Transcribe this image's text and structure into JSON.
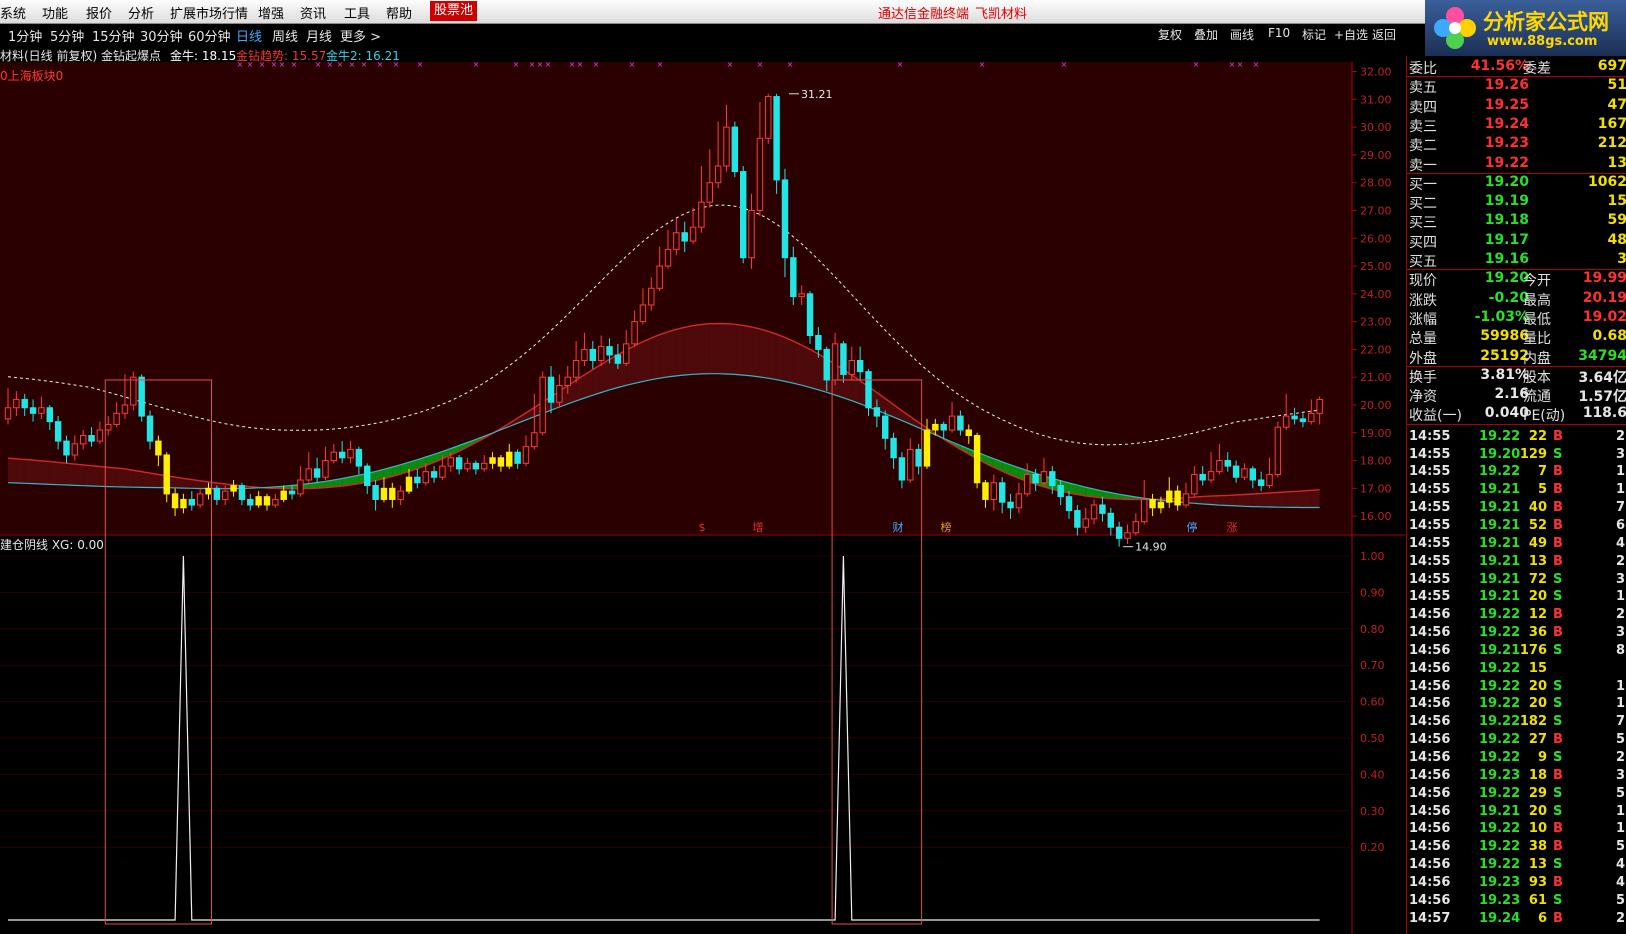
{
  "menu": [
    "系统",
    "功能",
    "报价",
    "分析",
    "扩展市场行情",
    "增强",
    "资讯",
    "工具",
    "帮助"
  ],
  "menu_pool": "股票池",
  "menu_center": [
    "通达信金融终端",
    "飞凯材料"
  ],
  "logo": {
    "title": "分析家公式网",
    "url": "www.88gs.com"
  },
  "periods": [
    "1分钟",
    "5分钟",
    "15分钟",
    "30分钟",
    "60分钟",
    "日线",
    "周线",
    "月线",
    "更多 >"
  ],
  "active_period": "日线",
  "toolbar_right": [
    "复权",
    "叠加",
    "画线",
    "F10",
    "标记",
    "+自选",
    "返回"
  ],
  "info": {
    "title": "材料(日线 前复权) 金钻起爆点",
    "items": [
      {
        "text": "金牛: 18.15",
        "color": "#ffffff"
      },
      {
        "text": "金钻趋势: 15.57",
        "color": "#ff3030"
      },
      {
        "text": "金牛2: 16.21",
        "color": "#33d0e8"
      }
    ]
  },
  "sub_label": "0上海板块0",
  "indicator_label": "建仓阴线 XG: 0.00",
  "price_axis": [
    "32.00",
    "31.00",
    "30.00",
    "29.00",
    "28.00",
    "27.00",
    "26.00",
    "25.00",
    "24.00",
    "23.00",
    "22.00",
    "21.00",
    "20.00",
    "19.00",
    "18.00",
    "17.00",
    "16.00"
  ],
  "ind_axis": [
    "1.00",
    "0.90",
    "0.80",
    "0.70",
    "0.60",
    "0.50",
    "0.40",
    "0.30",
    "0.20"
  ],
  "annotations": {
    "high": "31.21",
    "low": "14.90"
  },
  "event_marks": [
    "$",
    "增",
    "财",
    "榜",
    "停",
    "涨"
  ],
  "colors": {
    "bg_upper": "#2a0000",
    "up": "#ff3a3a",
    "down": "#22e6e6",
    "green_band": "#0c8a0c",
    "red_band": "#4e0a0a",
    "yellow": "#ffee00"
  },
  "chart_data": {
    "type": "candlestick",
    "ylim": [
      15.5,
      32.2
    ],
    "bars": [
      [
        19.5,
        19.9,
        20.6,
        19.3
      ],
      [
        19.9,
        20.2,
        20.5,
        19.6
      ],
      [
        20.2,
        19.9,
        20.4,
        19.6
      ],
      [
        19.9,
        19.7,
        20.2,
        19.4
      ],
      [
        19.7,
        19.9,
        20.3,
        19.5
      ],
      [
        19.9,
        19.4,
        20.0,
        19.1
      ],
      [
        19.4,
        18.7,
        19.6,
        18.4
      ],
      [
        18.7,
        18.2,
        18.9,
        17.9
      ],
      [
        18.2,
        18.6,
        18.9,
        18.0
      ],
      [
        18.6,
        18.9,
        19.1,
        18.4
      ],
      [
        18.9,
        18.7,
        19.2,
        18.5
      ],
      [
        18.7,
        19.1,
        19.4,
        18.6
      ],
      [
        19.1,
        19.3,
        19.6,
        18.9
      ],
      [
        19.3,
        19.7,
        20.1,
        19.2
      ],
      [
        19.7,
        20.0,
        21.1,
        19.5
      ],
      [
        20.0,
        21.0,
        21.2,
        19.8
      ],
      [
        21.0,
        19.6,
        21.1,
        19.4
      ],
      [
        19.6,
        18.7,
        19.8,
        18.4
      ],
      [
        18.7,
        18.2,
        18.9,
        17.8
      ],
      [
        18.2,
        16.8,
        18.3,
        16.5
      ],
      [
        16.8,
        16.3,
        17.0,
        16.0
      ],
      [
        16.3,
        16.6,
        16.8,
        16.1
      ],
      [
        16.6,
        16.4,
        16.9,
        16.2
      ],
      [
        16.4,
        16.8,
        17.0,
        16.3
      ],
      [
        16.8,
        17.0,
        17.2,
        16.6
      ],
      [
        17.0,
        16.6,
        17.1,
        16.4
      ],
      [
        16.6,
        16.9,
        17.1,
        16.4
      ],
      [
        16.9,
        17.1,
        17.3,
        16.7
      ],
      [
        17.1,
        16.6,
        17.2,
        16.4
      ],
      [
        16.6,
        16.4,
        16.8,
        16.2
      ],
      [
        16.4,
        16.7,
        16.9,
        16.3
      ],
      [
        16.7,
        16.4,
        16.8,
        16.2
      ],
      [
        16.4,
        16.6,
        16.8,
        16.3
      ],
      [
        16.6,
        16.9,
        17.1,
        16.5
      ],
      [
        16.9,
        16.8,
        17.1,
        16.6
      ],
      [
        16.8,
        17.3,
        17.8,
        16.7
      ],
      [
        17.3,
        17.7,
        18.3,
        17.2
      ],
      [
        17.7,
        17.4,
        18.1,
        17.2
      ],
      [
        17.4,
        18.0,
        18.5,
        17.3
      ],
      [
        18.0,
        18.3,
        18.6,
        17.9
      ],
      [
        18.3,
        18.1,
        18.7,
        17.9
      ],
      [
        18.1,
        18.4,
        18.7,
        17.9
      ],
      [
        18.4,
        17.8,
        18.5,
        17.5
      ],
      [
        17.8,
        17.1,
        17.9,
        16.8
      ],
      [
        17.1,
        16.6,
        17.3,
        16.2
      ],
      [
        16.6,
        17.0,
        17.4,
        16.5
      ],
      [
        17.0,
        16.6,
        17.2,
        16.3
      ],
      [
        16.6,
        16.9,
        17.1,
        16.4
      ],
      [
        16.9,
        17.4,
        17.7,
        16.8
      ],
      [
        17.4,
        17.2,
        17.7,
        17.0
      ],
      [
        17.2,
        17.6,
        17.9,
        17.1
      ],
      [
        17.6,
        17.4,
        17.8,
        17.2
      ],
      [
        17.4,
        17.8,
        18.2,
        17.3
      ],
      [
        17.8,
        18.1,
        18.3,
        17.6
      ],
      [
        18.1,
        17.7,
        18.2,
        17.5
      ],
      [
        17.7,
        17.9,
        18.1,
        17.6
      ],
      [
        17.9,
        17.7,
        18.0,
        17.5
      ],
      [
        17.7,
        17.9,
        18.2,
        17.6
      ],
      [
        17.9,
        18.1,
        18.3,
        17.7
      ],
      [
        18.1,
        17.8,
        18.2,
        17.6
      ],
      [
        17.8,
        18.3,
        18.6,
        17.7
      ],
      [
        18.3,
        17.9,
        18.4,
        17.7
      ],
      [
        17.9,
        18.5,
        18.9,
        17.8
      ],
      [
        18.5,
        19.0,
        20.4,
        18.4
      ],
      [
        19.0,
        21.0,
        21.2,
        18.9
      ],
      [
        21.0,
        20.1,
        21.4,
        19.7
      ],
      [
        20.1,
        20.7,
        21.1,
        19.9
      ],
      [
        20.7,
        21.0,
        21.4,
        20.4
      ],
      [
        21.0,
        21.6,
        22.3,
        20.8
      ],
      [
        21.6,
        22.0,
        22.6,
        21.4
      ],
      [
        22.0,
        21.6,
        22.3,
        21.3
      ],
      [
        21.6,
        22.1,
        22.5,
        21.4
      ],
      [
        22.1,
        21.8,
        22.4,
        21.5
      ],
      [
        21.8,
        21.5,
        22.2,
        21.3
      ],
      [
        21.5,
        22.2,
        22.7,
        21.4
      ],
      [
        22.2,
        23.0,
        23.4,
        22.1
      ],
      [
        23.0,
        23.6,
        24.2,
        22.9
      ],
      [
        23.6,
        24.2,
        24.6,
        23.4
      ],
      [
        24.2,
        25.0,
        25.7,
        24.1
      ],
      [
        25.0,
        25.6,
        26.3,
        24.9
      ],
      [
        25.6,
        26.2,
        26.7,
        25.4
      ],
      [
        26.2,
        25.9,
        26.6,
        25.5
      ],
      [
        25.9,
        26.4,
        27.1,
        25.8
      ],
      [
        26.4,
        27.3,
        28.6,
        26.2
      ],
      [
        27.3,
        28.0,
        29.2,
        27.1
      ],
      [
        28.0,
        28.6,
        30.2,
        27.8
      ],
      [
        28.6,
        30.0,
        30.8,
        28.4
      ],
      [
        30.0,
        28.4,
        30.2,
        28.2
      ],
      [
        28.4,
        25.3,
        28.6,
        25.1
      ],
      [
        25.3,
        27.0,
        27.6,
        24.9
      ],
      [
        27.0,
        29.6,
        30.9,
        26.8
      ],
      [
        29.6,
        31.1,
        31.2,
        29.4
      ],
      [
        31.1,
        28.1,
        31.2,
        27.6
      ],
      [
        28.1,
        25.3,
        28.5,
        24.6
      ],
      [
        25.3,
        23.9,
        25.7,
        23.6
      ],
      [
        23.9,
        24.0,
        24.3,
        23.6
      ],
      [
        24.0,
        22.5,
        24.1,
        22.2
      ],
      [
        22.5,
        22.0,
        22.8,
        21.7
      ],
      [
        22.0,
        20.9,
        22.1,
        20.5
      ],
      [
        20.9,
        22.2,
        22.6,
        20.7
      ],
      [
        22.2,
        21.1,
        22.3,
        20.8
      ],
      [
        21.1,
        21.6,
        22.1,
        20.9
      ],
      [
        21.6,
        21.2,
        22.1,
        20.9
      ],
      [
        21.2,
        19.9,
        21.3,
        19.6
      ],
      [
        19.9,
        19.6,
        20.2,
        19.2
      ],
      [
        19.6,
        18.8,
        19.8,
        18.4
      ],
      [
        18.8,
        18.1,
        19.0,
        17.7
      ],
      [
        18.1,
        17.3,
        18.3,
        17.0
      ],
      [
        17.3,
        18.4,
        18.8,
        17.2
      ],
      [
        18.4,
        17.8,
        18.6,
        17.5
      ],
      [
        17.8,
        19.1,
        19.5,
        17.7
      ],
      [
        19.1,
        19.3,
        19.5,
        18.9
      ],
      [
        19.3,
        19.1,
        19.4,
        18.8
      ],
      [
        19.1,
        19.6,
        20.1,
        19.0
      ],
      [
        19.6,
        19.1,
        19.8,
        18.9
      ],
      [
        19.1,
        18.9,
        19.3,
        18.6
      ],
      [
        18.9,
        17.2,
        19.0,
        17.0
      ],
      [
        17.2,
        16.6,
        17.3,
        16.3
      ],
      [
        16.6,
        17.2,
        17.5,
        16.2
      ],
      [
        17.2,
        16.5,
        17.4,
        16.1
      ],
      [
        16.5,
        16.3,
        16.8,
        15.9
      ],
      [
        16.3,
        16.8,
        17.2,
        16.1
      ],
      [
        16.8,
        17.5,
        17.9,
        16.7
      ],
      [
        17.5,
        17.2,
        17.7,
        16.9
      ],
      [
        17.2,
        17.6,
        18.1,
        17.1
      ],
      [
        17.6,
        17.1,
        17.8,
        16.8
      ],
      [
        17.1,
        16.7,
        17.3,
        16.4
      ],
      [
        16.7,
        16.2,
        16.9,
        15.9
      ],
      [
        16.2,
        15.6,
        16.4,
        15.3
      ],
      [
        15.6,
        15.9,
        16.3,
        15.4
      ],
      [
        15.9,
        16.4,
        16.6,
        15.7
      ],
      [
        16.4,
        16.1,
        16.7,
        15.8
      ],
      [
        16.1,
        15.6,
        16.3,
        15.3
      ],
      [
        15.6,
        15.2,
        15.8,
        14.9
      ],
      [
        15.2,
        15.4,
        15.7,
        15.0
      ],
      [
        15.4,
        15.8,
        16.1,
        15.3
      ],
      [
        15.8,
        16.6,
        17.3,
        15.7
      ],
      [
        16.6,
        16.3,
        16.8,
        16.0
      ],
      [
        16.3,
        16.5,
        16.7,
        16.1
      ],
      [
        16.5,
        16.9,
        17.4,
        16.3
      ],
      [
        16.9,
        16.4,
        17.1,
        16.2
      ],
      [
        16.4,
        16.8,
        17.2,
        16.3
      ],
      [
        16.8,
        17.5,
        17.8,
        16.7
      ],
      [
        17.5,
        17.3,
        17.8,
        17.1
      ],
      [
        17.3,
        17.6,
        18.3,
        17.2
      ],
      [
        17.6,
        18.0,
        18.6,
        17.5
      ],
      [
        18.0,
        17.8,
        18.3,
        17.6
      ],
      [
        17.8,
        17.4,
        18.0,
        17.2
      ],
      [
        17.4,
        17.7,
        17.9,
        17.3
      ],
      [
        17.7,
        17.3,
        17.8,
        17.0
      ],
      [
        17.3,
        17.1,
        17.6,
        16.9
      ],
      [
        17.1,
        17.5,
        18.1,
        17.0
      ],
      [
        17.5,
        19.2,
        19.4,
        17.4
      ],
      [
        19.2,
        19.6,
        20.4,
        19.1
      ],
      [
        19.6,
        19.5,
        19.9,
        19.3
      ],
      [
        19.5,
        19.4,
        19.7,
        19.2
      ],
      [
        19.4,
        19.7,
        20.2,
        19.3
      ],
      [
        19.7,
        20.2,
        20.3,
        19.3
      ]
    ],
    "yellow_bars": [
      18,
      19,
      20,
      21,
      24,
      27,
      30,
      31,
      33,
      45,
      46,
      48,
      58,
      59,
      60,
      110,
      111,
      115,
      116,
      117,
      137,
      138,
      139,
      140
    ],
    "signal_bars": [
      21,
      100
    ]
  },
  "quote": {
    "rows": [
      [
        "委比",
        "41.56%",
        "委差",
        "697"
      ],
      [
        "卖五",
        "19.26",
        "",
        "51"
      ],
      [
        "卖四",
        "19.25",
        "",
        "47"
      ],
      [
        "卖三",
        "19.24",
        "",
        "167"
      ],
      [
        "卖二",
        "19.23",
        "",
        "212"
      ],
      [
        "卖一",
        "19.22",
        "",
        "13"
      ],
      [
        "买一",
        "19.20",
        "",
        "1062"
      ],
      [
        "买二",
        "19.19",
        "",
        "15"
      ],
      [
        "买三",
        "19.18",
        "",
        "59"
      ],
      [
        "买四",
        "19.17",
        "",
        "48"
      ],
      [
        "买五",
        "19.16",
        "",
        "3"
      ],
      [
        "现价",
        "19.20",
        "今开",
        "19.99"
      ],
      [
        "涨跌",
        "-0.20",
        "最高",
        "20.19"
      ],
      [
        "涨幅",
        "-1.03%",
        "最低",
        "19.02"
      ],
      [
        "总量",
        "59986",
        "量比",
        "0.68"
      ],
      [
        "外盘",
        "25192",
        "内盘",
        "34794"
      ],
      [
        "换手",
        "3.81%",
        "股本",
        "3.64亿"
      ],
      [
        "净资",
        "2.16",
        "流通",
        "1.57亿"
      ],
      [
        "收益(一)",
        "0.040",
        "PE(动)",
        "118.6"
      ]
    ],
    "ticks": [
      [
        "14:55",
        "19.22",
        "22",
        "B",
        "2"
      ],
      [
        "14:55",
        "19.20",
        "129",
        "S",
        "3"
      ],
      [
        "14:55",
        "19.22",
        "7",
        "B",
        "1"
      ],
      [
        "14:55",
        "19.21",
        "5",
        "B",
        "1"
      ],
      [
        "14:55",
        "19.21",
        "40",
        "B",
        "7"
      ],
      [
        "14:55",
        "19.21",
        "52",
        "B",
        "6"
      ],
      [
        "14:55",
        "19.21",
        "49",
        "B",
        "4"
      ],
      [
        "14:55",
        "19.21",
        "13",
        "B",
        "2"
      ],
      [
        "14:55",
        "19.21",
        "72",
        "S",
        "3"
      ],
      [
        "14:55",
        "19.21",
        "20",
        "S",
        "1"
      ],
      [
        "14:56",
        "19.22",
        "12",
        "B",
        "2"
      ],
      [
        "14:56",
        "19.22",
        "36",
        "B",
        "3"
      ],
      [
        "14:56",
        "19.21",
        "176",
        "S",
        "8"
      ],
      [
        "14:56",
        "19.22",
        "15",
        "",
        ""
      ],
      [
        "14:56",
        "19.22",
        "20",
        "S",
        "1"
      ],
      [
        "14:56",
        "19.22",
        "20",
        "S",
        "1"
      ],
      [
        "14:56",
        "19.22",
        "182",
        "S",
        "7"
      ],
      [
        "14:56",
        "19.22",
        "27",
        "B",
        "5"
      ],
      [
        "14:56",
        "19.22",
        "9",
        "S",
        "2"
      ],
      [
        "14:56",
        "19.23",
        "18",
        "B",
        "3"
      ],
      [
        "14:56",
        "19.22",
        "29",
        "S",
        "5"
      ],
      [
        "14:56",
        "19.21",
        "20",
        "S",
        "1"
      ],
      [
        "14:56",
        "19.22",
        "10",
        "B",
        "1"
      ],
      [
        "14:56",
        "19.22",
        "38",
        "B",
        "5"
      ],
      [
        "14:56",
        "19.22",
        "13",
        "S",
        "4"
      ],
      [
        "14:56",
        "19.23",
        "93",
        "B",
        "4"
      ],
      [
        "14:56",
        "19.23",
        "61",
        "S",
        "5"
      ],
      [
        "14:57",
        "19.24",
        "6",
        "B",
        "2"
      ]
    ]
  }
}
